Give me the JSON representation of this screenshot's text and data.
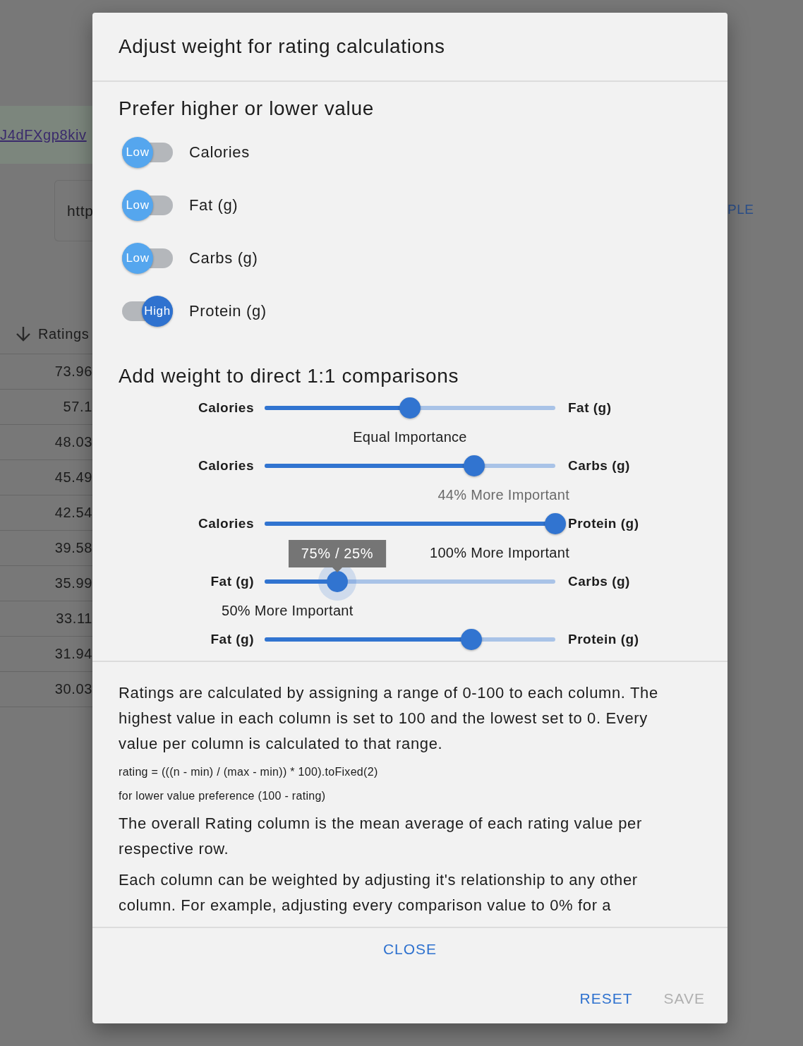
{
  "background": {
    "link": "J4dFXgp8kiv",
    "url_field": {
      "value": "http"
    },
    "table": {
      "header": "Ratings",
      "rows": [
        "73.96",
        "57.1",
        "48.03",
        "45.49",
        "42.54",
        "39.58",
        "35.99",
        "33.11",
        "31.94",
        "30.03"
      ]
    },
    "example_button": "PLE"
  },
  "dialog": {
    "title": "Adjust weight for rating calculations",
    "preference": {
      "heading": "Prefer higher or lower value",
      "toggles": [
        {
          "label": "Calories",
          "thumb": "Low",
          "on": false
        },
        {
          "label": "Fat (g)",
          "thumb": "Low",
          "on": false
        },
        {
          "label": "Carbs (g)",
          "thumb": "Low",
          "on": false
        },
        {
          "label": "Protein (g)",
          "thumb": "High",
          "on": true
        }
      ]
    },
    "weights": {
      "heading": "Add weight to direct 1:1 comparisons",
      "sliders": [
        {
          "kind": "center",
          "left": "Calories",
          "right": "Fat (g)",
          "level": 0.5,
          "caption": "Equal Importance",
          "dimmed": false,
          "focused": false
        },
        {
          "kind": "end",
          "left": "Calories",
          "right": "Carbs (g)",
          "level": 0.72,
          "caption": "44% More Important",
          "dimmed": true,
          "focused": false
        },
        {
          "kind": "end",
          "left": "Calories",
          "right": "Protein (g)",
          "level": 1,
          "caption": "100% More Important",
          "dimmed": false,
          "focused": false
        },
        {
          "kind": "start",
          "left": "Fat (g)",
          "right": "Carbs (g)",
          "level": 0.25,
          "caption": "50% More Important",
          "dimmed": false,
          "focused": true,
          "tooltip": "75% / 25%"
        },
        {
          "left": "Fat (g)",
          "right": "Protein (g)",
          "level": 0.71,
          "focused": false
        }
      ]
    },
    "help": [
      {
        "kind": "body",
        "text": "Ratings are calculated by assigning a range of 0-100 to each column. The highest value in each column is set to 100 and the lowest set to 0. Every value per column is calculated to that range."
      },
      {
        "kind": "code",
        "text": "rating = (((n - min) / (max - min)) * 100).toFixed(2)"
      },
      {
        "kind": "code",
        "text": "for lower value preference (100 - rating)"
      },
      {
        "kind": "body",
        "text": "The overall Rating column is the mean average of each rating value per respective row."
      },
      {
        "kind": "body",
        "text": "Each column can be weighted by adjusting it's relationship to any other column. For example, adjusting every comparison value to 0% for a"
      }
    ],
    "close": {
      "label": "CLOSE",
      "disabled": false
    },
    "buttons": [
      {
        "label": "RESET",
        "disabled": false
      },
      {
        "label": "SAVE",
        "disabled": true
      }
    ]
  }
}
